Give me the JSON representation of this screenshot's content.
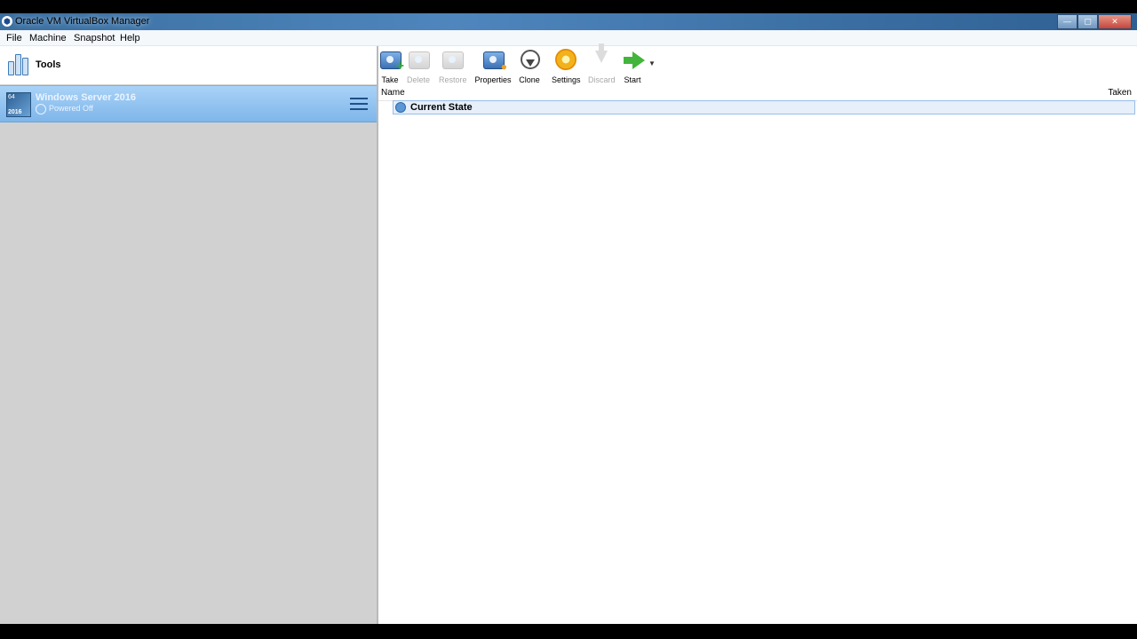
{
  "window": {
    "title": "Oracle VM VirtualBox Manager",
    "app_icon": "virtualbox-icon",
    "controls": [
      "minimize",
      "maximize",
      "close"
    ]
  },
  "menu": {
    "items": [
      "File",
      "Machine",
      "Snapshot",
      "Help"
    ]
  },
  "sidebar": {
    "tools_label": "Tools",
    "tools_icon": "tools-icon",
    "vm": {
      "name": "Windows Server 2016",
      "state": "Powered Off",
      "os_icon_badge": "2016",
      "os_icon_bits": "64",
      "selected": true
    }
  },
  "toolbar": {
    "buttons": [
      {
        "label": "Take",
        "icon": "take-snapshot-icon",
        "enabled": true
      },
      {
        "label": "Delete",
        "icon": "delete-snapshot-icon",
        "enabled": false
      },
      {
        "label": "Restore",
        "icon": "restore-snapshot-icon",
        "enabled": false
      },
      {
        "label": "Properties",
        "icon": "properties-icon",
        "enabled": true
      },
      {
        "label": "Clone",
        "icon": "clone-icon",
        "enabled": true
      },
      {
        "label": "Settings",
        "icon": "settings-gear-icon",
        "enabled": true
      },
      {
        "label": "Discard",
        "icon": "discard-icon",
        "enabled": false
      },
      {
        "label": "Start",
        "icon": "start-arrow-icon",
        "enabled": true
      }
    ]
  },
  "snapshots": {
    "columns": [
      "Name",
      "Taken"
    ],
    "rows": [
      {
        "name": "Current State",
        "taken": "",
        "icon": "current-state-icon"
      }
    ]
  },
  "colors": {
    "selection": "#8fc1ef",
    "left_panel_bg": "#d1d1d1",
    "title_bar": "#4e86bd"
  }
}
